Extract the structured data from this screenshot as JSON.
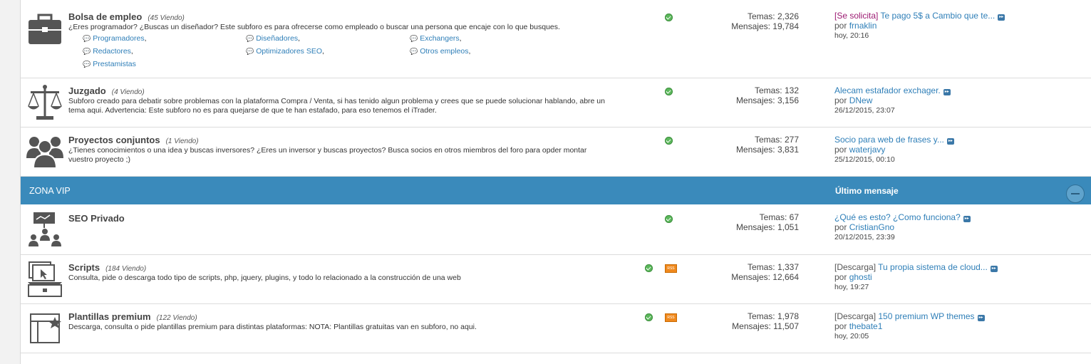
{
  "forums_top": [
    {
      "title": "Bolsa de empleo",
      "viewing": "(45 Viendo)",
      "description": "¿Eres programador? ¿Buscas un diseñador? Este subforo es para ofrecerse como empleado o buscar una persona que encaje con lo que busques.",
      "subforums": [
        "Programadores",
        "Diseñadores",
        "Exchangers",
        "Redactores",
        "Optimizadores SEO",
        "Otros empleos",
        "Prestamistas"
      ],
      "stats": {
        "topics": "Temas: 2,326",
        "posts": "Mensajes: 19,784"
      },
      "last": {
        "prefix": "[Se solicita]",
        "title": "Te pago 5$ a Cambio que te...",
        "by": "por",
        "user": "frnaklin",
        "date": "hoy, 20:16"
      }
    },
    {
      "title": "Juzgado",
      "viewing": "(4 Viendo)",
      "description": "Subforo creado para debatir sobre problemas con la plataforma Compra / Venta, si has tenido algun problema y crees que se puede solucionar hablando, abre un tema aqui. Advertencia: Este subforo no es para quejarse de que te han estafado, para eso tenemos el iTrader.",
      "stats": {
        "topics": "Temas: 132",
        "posts": "Mensajes: 3,156"
      },
      "last": {
        "prefix": "",
        "title": "Alecam estafador exchager.",
        "by": "por",
        "user": "DNew",
        "date": "26/12/2015, 23:07"
      }
    },
    {
      "title": "Proyectos conjuntos",
      "viewing": "(1 Viendo)",
      "description": "¿Tienes conocimientos o una idea y buscas inversores? ¿Eres un inversor y buscas proyectos? Busca socios en otros miembros del foro para opder montar vuestro proyecto ;)",
      "stats": {
        "topics": "Temas: 277",
        "posts": "Mensajes: 3,831"
      },
      "last": {
        "prefix": "",
        "title": "Socio para web de frases y...",
        "by": "por",
        "user": "waterjavy",
        "date": "25/12/2015, 00:10"
      }
    }
  ],
  "section": {
    "name": "ZONA VIP",
    "last_post_header": "Último mensaje"
  },
  "forums_vip": [
    {
      "title": "SEO Privado",
      "viewing": "",
      "description": "",
      "stats": {
        "topics": "Temas: 67",
        "posts": "Mensajes: 1,051"
      },
      "last": {
        "prefix": "",
        "title": "¿Qué es esto? ¿Como funciona?",
        "by": "por",
        "user": "CristianGno",
        "date": "20/12/2015, 23:39"
      }
    },
    {
      "title": "Scripts",
      "viewing": "(184 Viendo)",
      "description": "Consulta, pide o descarga todo tipo de scripts, php, jquery, plugins, y todo lo relacionado a la construcción de una web",
      "stats": {
        "topics": "Temas: 1,337",
        "posts": "Mensajes: 12,664"
      },
      "last": {
        "prefix": "[Descarga]",
        "title": "Tu propia sistema de cloud...",
        "by": "por",
        "user": "ghosti",
        "date": "hoy, 19:27"
      }
    },
    {
      "title": "Plantillas premium",
      "viewing": "(122 Viendo)",
      "description": "Descarga, consulta o pide plantillas premium para distintas plataformas: NOTA: Plantillas gratuitas van en subforo, no aqui.",
      "stats": {
        "topics": "Temas: 1,978",
        "posts": "Mensajes: 11,507"
      },
      "last": {
        "prefix": "[Descarga]",
        "title": "150 premium WP themes",
        "by": "por",
        "user": "thebate1",
        "date": "hoy, 20:05"
      }
    }
  ],
  "colors": {
    "header_bg": "#3a8abb",
    "link": "#2f7fb8",
    "status_green": "#5cb85c",
    "rss_orange": "#f0891d"
  }
}
